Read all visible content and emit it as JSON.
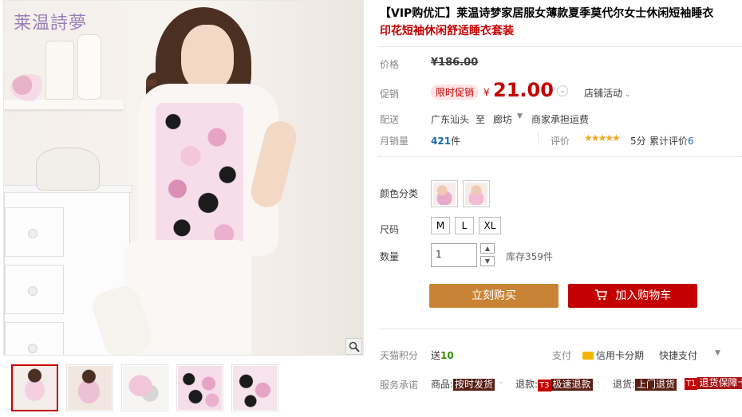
{
  "logo": "莱温詩夢",
  "title": {
    "line1": "【VIP购优汇】莱温诗梦家居服女薄款夏季莫代尔女士休闲短袖睡衣",
    "line2": "印花短袖休闲舒适睡衣套装"
  },
  "price": {
    "label": "价格",
    "original": "¥186.00",
    "promo_label": "促销",
    "promo_tag": "限时促销",
    "currency": "¥",
    "current": "21.00",
    "shop_promo": "店铺活动"
  },
  "shipping": {
    "label": "配送",
    "from": "广东汕头",
    "to_word": "至",
    "city": "廊坊",
    "note": "商家承担运费"
  },
  "sales": {
    "label": "月销量",
    "count": "421",
    "unit": "件",
    "rating_label": "评价",
    "stars": "★★★★★",
    "score": "5分",
    "total_label": "累计评价",
    "total_count": "6"
  },
  "color": {
    "label": "颜色分类"
  },
  "size": {
    "label": "尺码",
    "options": [
      "M",
      "L",
      "XL"
    ]
  },
  "quantity": {
    "label": "数量",
    "value": "1",
    "stock": "库存359件"
  },
  "actions": {
    "buy_now": "立刻购买",
    "add_to_cart": "加入购物车"
  },
  "points": {
    "label": "天猫积分",
    "send": "送",
    "amount": "10",
    "pay_label": "支付",
    "credit_card": "信用卡分期",
    "quick_pay": "快捷支付"
  },
  "services": {
    "label": "服务承诺",
    "goods_prefix": "商品:",
    "goods_tag": "按时发货",
    "refund_prefix": "退款:",
    "refund_mark": "T3",
    "refund_tag": "极速退款",
    "return_prefix": "退货:",
    "return_tag": "上门退货",
    "guarantee_mark": "T1",
    "guarantee_tag": "退货保障卡"
  },
  "colors": {
    "price_red": "#c40000",
    "buy_orange": "#c98335",
    "link_blue": "#1a6bb5",
    "points_green": "#338f00"
  }
}
